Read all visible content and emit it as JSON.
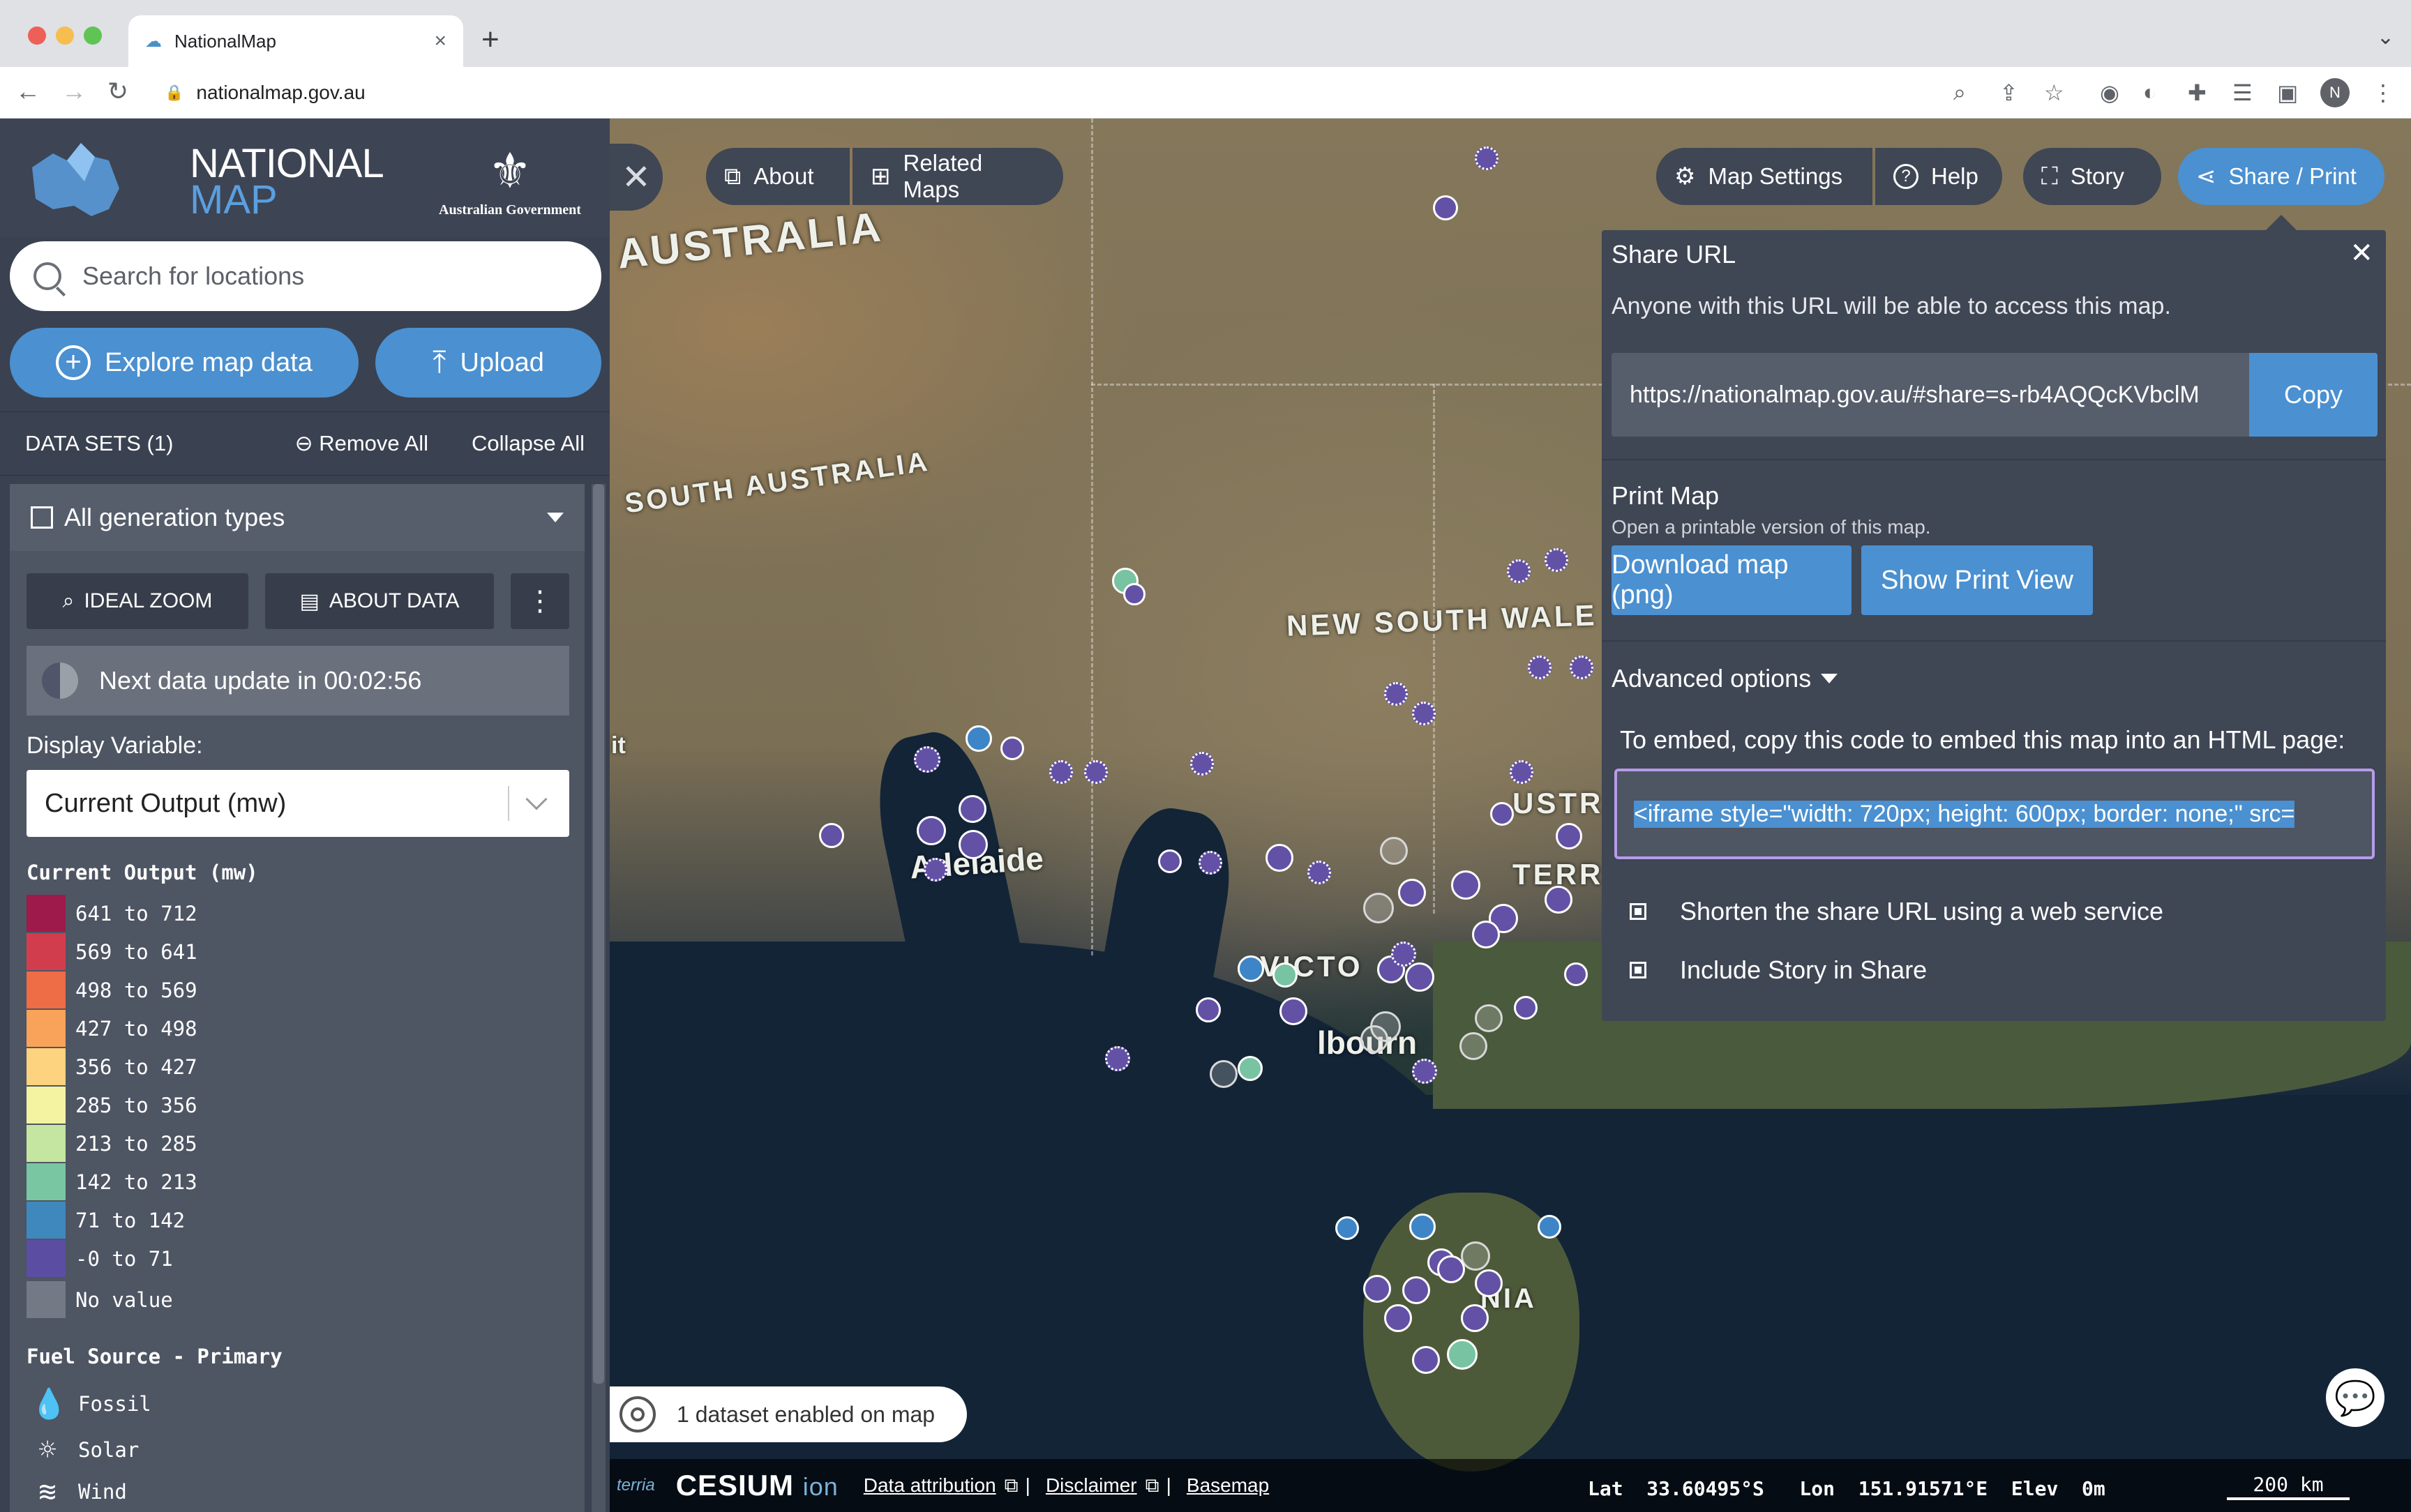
{
  "browser": {
    "tab_title": "NationalMap",
    "new_tab_symbol": "+",
    "url": "nationalmap.gov.au",
    "profile_initial": "N"
  },
  "sidebar": {
    "brand_line1": "NATIONAL",
    "brand_line2": "MAP",
    "govt_label": "Australian Government",
    "search_placeholder": "Search for locations",
    "explore_button": "Explore map data",
    "upload_button": "Upload",
    "datasets_label": "DATA SETS (1)",
    "remove_all": "Remove All",
    "collapse_all": "Collapse All",
    "workbench_item": {
      "title": "All generation types",
      "ideal_zoom": "IDEAL ZOOM",
      "about_data": "ABOUT DATA",
      "next_update": "Next data update in 00:02:56",
      "display_variable_label": "Display Variable:",
      "display_variable_value": "Current Output (mw)",
      "legend_title": "Current Output (mw)",
      "legend": [
        {
          "label": "641 to 712",
          "color": "#9e1a4a"
        },
        {
          "label": "569 to 641",
          "color": "#d23d4e"
        },
        {
          "label": "498 to 569",
          "color": "#ee6c46"
        },
        {
          "label": "427 to 498",
          "color": "#f9a25a"
        },
        {
          "label": "356 to 427",
          "color": "#fdd380"
        },
        {
          "label": "285 to 356",
          "color": "#f4f3a2"
        },
        {
          "label": "213 to 285",
          "color": "#c4e6a0"
        },
        {
          "label": "142 to 213",
          "color": "#79c6a2"
        },
        {
          "label": "71 to 142",
          "color": "#3f88bd"
        },
        {
          "label": "-0 to 71",
          "color": "#5b4ea2"
        },
        {
          "label": "No value",
          "color": "#737985"
        }
      ],
      "fuel_title": "Fuel Source - Primary",
      "fuel": [
        {
          "label": "Fossil",
          "icon": "droplet-icon"
        },
        {
          "label": "Solar",
          "icon": "sun-icon"
        },
        {
          "label": "Wind",
          "icon": "wind-icon"
        }
      ]
    }
  },
  "toolbar": {
    "about": "About",
    "related_maps": "Related Maps",
    "map_settings": "Map Settings",
    "help": "Help",
    "story": "Story",
    "share_print": "Share / Print"
  },
  "map": {
    "labels": [
      "AUSTRALIA",
      "SOUTH AUSTRALIA",
      "NEW SOUTH WALE",
      "Adelaide",
      "VICTO",
      "lbourn",
      "USTR",
      "TERRI",
      "NIA",
      "it"
    ]
  },
  "share_panel": {
    "title": "Share URL",
    "subtitle": "Anyone with this URL will be able to access this map.",
    "share_url": "https://nationalmap.gov.au/#share=s-rb4AQQcKVbclM",
    "copy": "Copy",
    "print_title": "Print Map",
    "print_sub": "Open a printable version of this map.",
    "download_button": "Download map (png)",
    "print_view_button": "Show Print View",
    "advanced": "Advanced options",
    "embed_label": "To embed, copy this code to embed this map into an HTML page:",
    "embed_code": "<iframe style=\"width: 720px; height: 600px; border: none;\" src=",
    "shorten_label": "Shorten the share URL using a web service",
    "story_label": "Include Story in Share"
  },
  "bottom": {
    "datasets_enabled": "1 dataset enabled on map",
    "terria": "terria",
    "cesium": "CESIUM",
    "ion": "ion",
    "attribution": "Data attribution",
    "disclaimer": "Disclaimer",
    "basemap": "Basemap",
    "sep": "|",
    "coords": "Lat  33.60495°S   Lon  151.91571°E  Elev  0m",
    "scale": "200 km"
  },
  "colors": {
    "accent": "#4b90d0",
    "panel": "#3a4150",
    "embed_border": "#b59ce8"
  }
}
